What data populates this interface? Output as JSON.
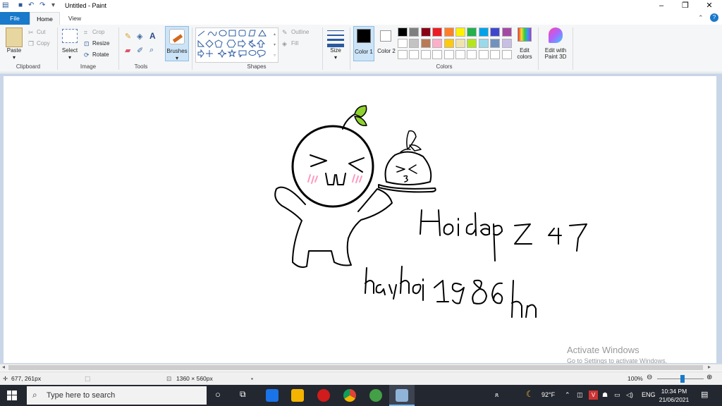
{
  "window": {
    "title": "Untitled - Paint"
  },
  "tabs": [
    "File",
    "Home",
    "View"
  ],
  "clipboard": {
    "paste": "Paste",
    "cut": "Cut",
    "copy": "Copy",
    "label": "Clipboard"
  },
  "image": {
    "select": "Select",
    "crop": "Crop",
    "resize": "Resize",
    "rotate": "Rotate",
    "label": "Image"
  },
  "tools": {
    "label": "Tools"
  },
  "brushes": {
    "label": "Brushes"
  },
  "shapes": {
    "label": "Shapes",
    "outline": "Outline",
    "fill": "Fill"
  },
  "size": {
    "label": "Size"
  },
  "colors": {
    "color1": "Color 1",
    "color2": "Color 2",
    "label": "Colors",
    "edit": "Edit colors",
    "paint3d": "Edit with Paint 3D",
    "row1": [
      "#000000",
      "#7f7f7f",
      "#880015",
      "#ed1c24",
      "#ff7f27",
      "#fff200",
      "#22b14c",
      "#00a2e8",
      "#3f48cc",
      "#a349a4"
    ],
    "row2": [
      "#ffffff",
      "#c3c3c3",
      "#b97a57",
      "#ffaec9",
      "#ffc90e",
      "#efe4b0",
      "#b5e61d",
      "#99d9ea",
      "#7092be",
      "#c8bfe7"
    ]
  },
  "drawing": {
    "line1": "Hoidap247",
    "line2": "hayhoi1986hn"
  },
  "status": {
    "cursor": "677, 261px",
    "size": "1360 × 560px",
    "zoom": "100%"
  },
  "watermark": {
    "title": "Activate Windows",
    "sub": "Go to Settings to activate Windows."
  },
  "taskbar": {
    "search_placeholder": "Type here to search",
    "temp": "92°F",
    "lang": "ENG",
    "time": "10:34 PM",
    "date": "21/06/2021"
  }
}
